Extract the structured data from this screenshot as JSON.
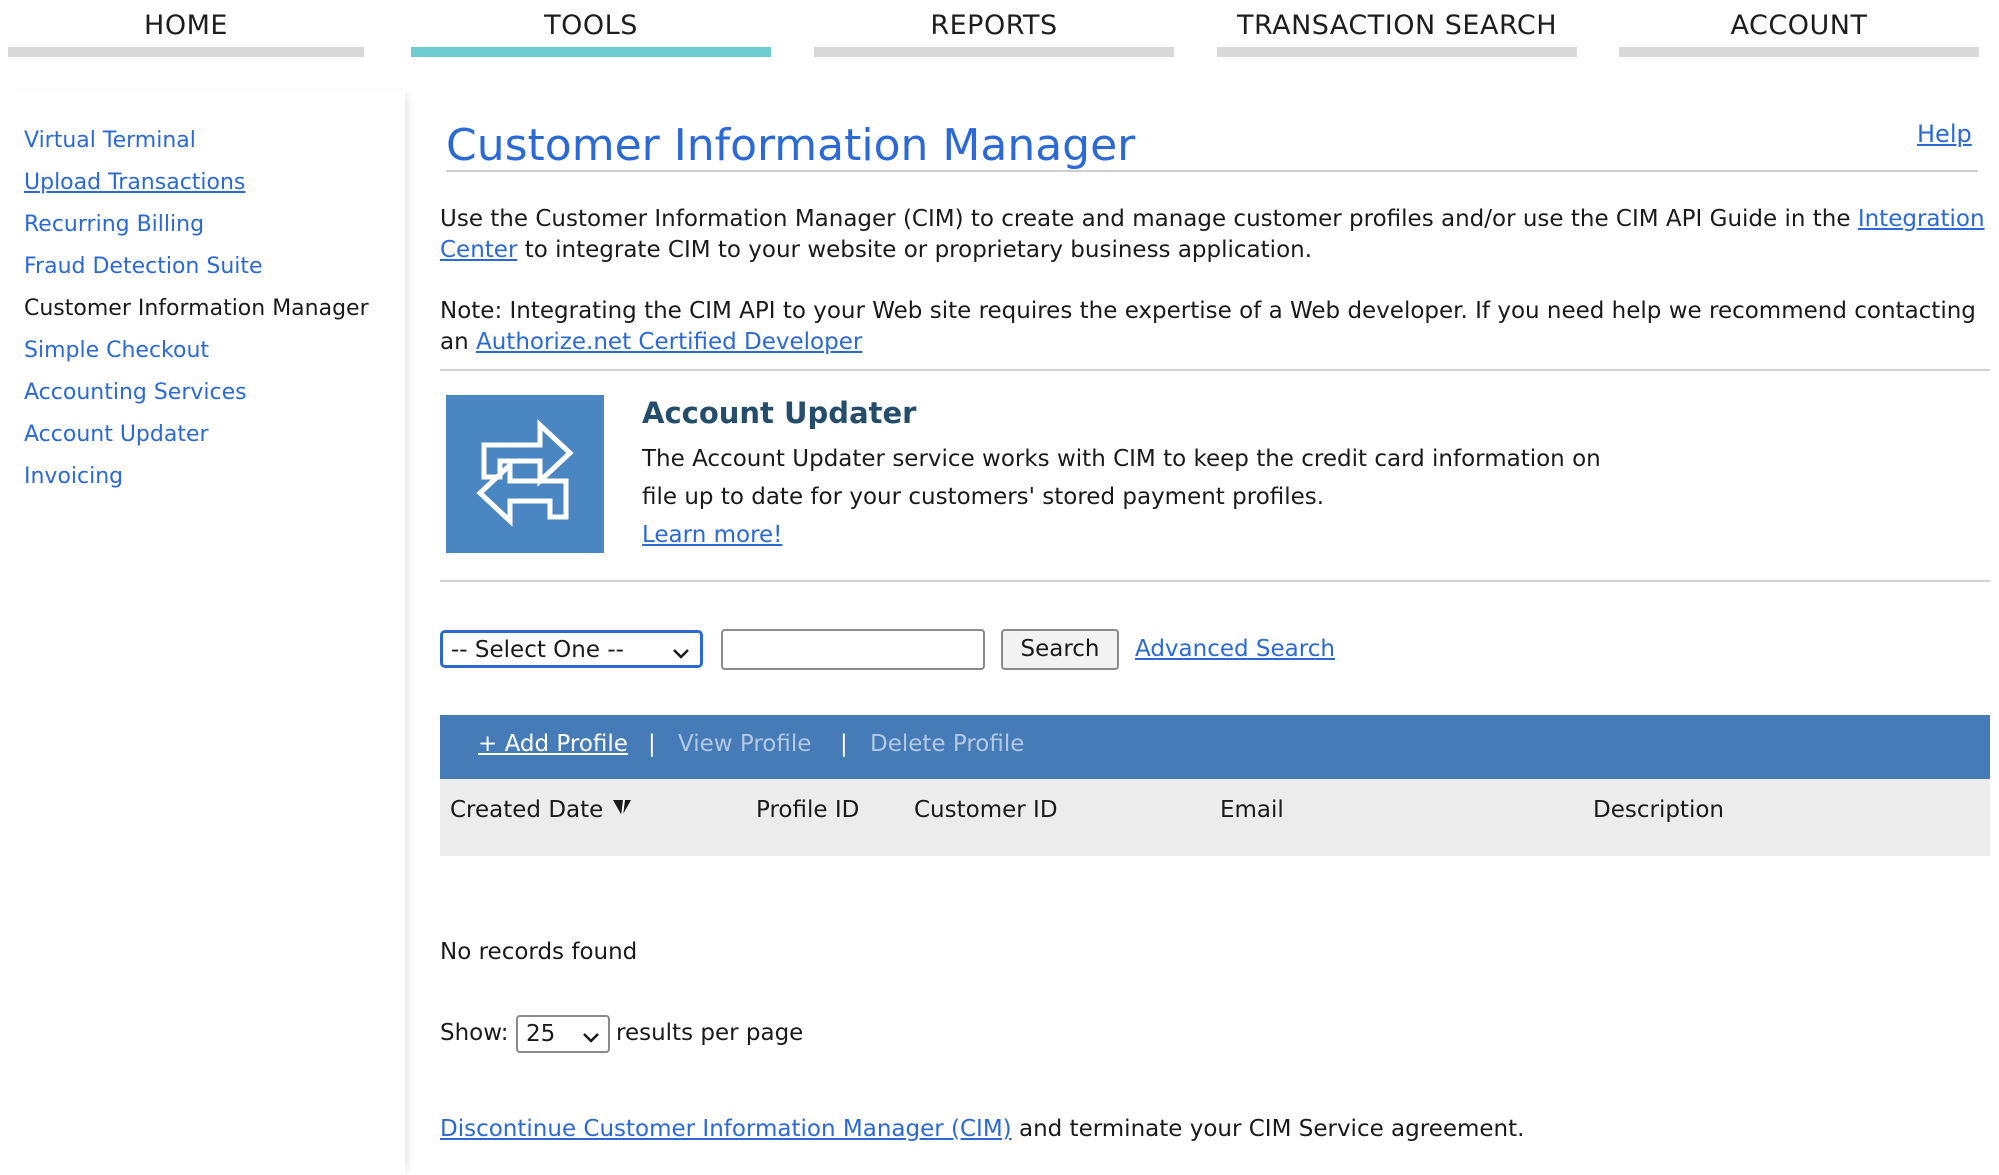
{
  "nav": {
    "tabs": [
      {
        "label": "HOME"
      },
      {
        "label": "TOOLS"
      },
      {
        "label": "REPORTS"
      },
      {
        "label": "TRANSACTION SEARCH"
      },
      {
        "label": "ACCOUNT"
      }
    ],
    "active_tab": "TOOLS",
    "active_color": "#6ecdd0"
  },
  "sidebar": {
    "items": [
      {
        "label": "Virtual Terminal"
      },
      {
        "label": "Upload Transactions"
      },
      {
        "label": "Recurring Billing"
      },
      {
        "label": "Fraud Detection Suite"
      },
      {
        "label": "Customer Information Manager"
      },
      {
        "label": "Simple Checkout"
      },
      {
        "label": "Accounting Services"
      },
      {
        "label": "Account Updater"
      },
      {
        "label": "Invoicing"
      }
    ],
    "current": "Customer Information Manager"
  },
  "main": {
    "title": "Customer Information Manager",
    "help": "Help",
    "intro": {
      "before": "Use the Customer Information Manager (CIM) to create and manage customer profiles and/or use the CIM API Guide in the",
      "link": "Integration Center",
      "after": "to integrate CIM to your website or proprietary business application."
    },
    "note": {
      "before": "Note: Integrating the CIM API to your Web site requires the expertise of a Web developer. If you need help we recommend contacting an",
      "link": "Authorize.net Certified Developer"
    },
    "account_updater": {
      "icon": "swap-arrows-icon",
      "title": "Account Updater",
      "text": "The Account Updater service works with CIM to keep the credit card information on file up to date for your customers' stored payment profiles.",
      "link": "Learn more!"
    },
    "search": {
      "select_value": "-- Select One --",
      "input_value": "",
      "button": "Search",
      "advanced": "Advanced Search"
    },
    "toolbar": {
      "add": "+ Add Profile",
      "sep": "|",
      "view": "View Profile",
      "delete": "Delete Profile"
    },
    "table": {
      "columns": [
        "Created Date",
        "Profile ID",
        "Customer ID",
        "Email",
        "Description"
      ],
      "sort_icon": "sort-down-icon",
      "empty": "No records found"
    },
    "pagination": {
      "show_label": "Show:",
      "per_page": "25",
      "suffix": "results per page"
    },
    "discontinue": {
      "link": "Discontinue Customer Information Manager (CIM)",
      "after": "and terminate your CIM Service agreement."
    }
  },
  "colors": {
    "link": "#2b6ad6",
    "toolbar": "#457bb7",
    "title_dark": "#244d6c"
  }
}
